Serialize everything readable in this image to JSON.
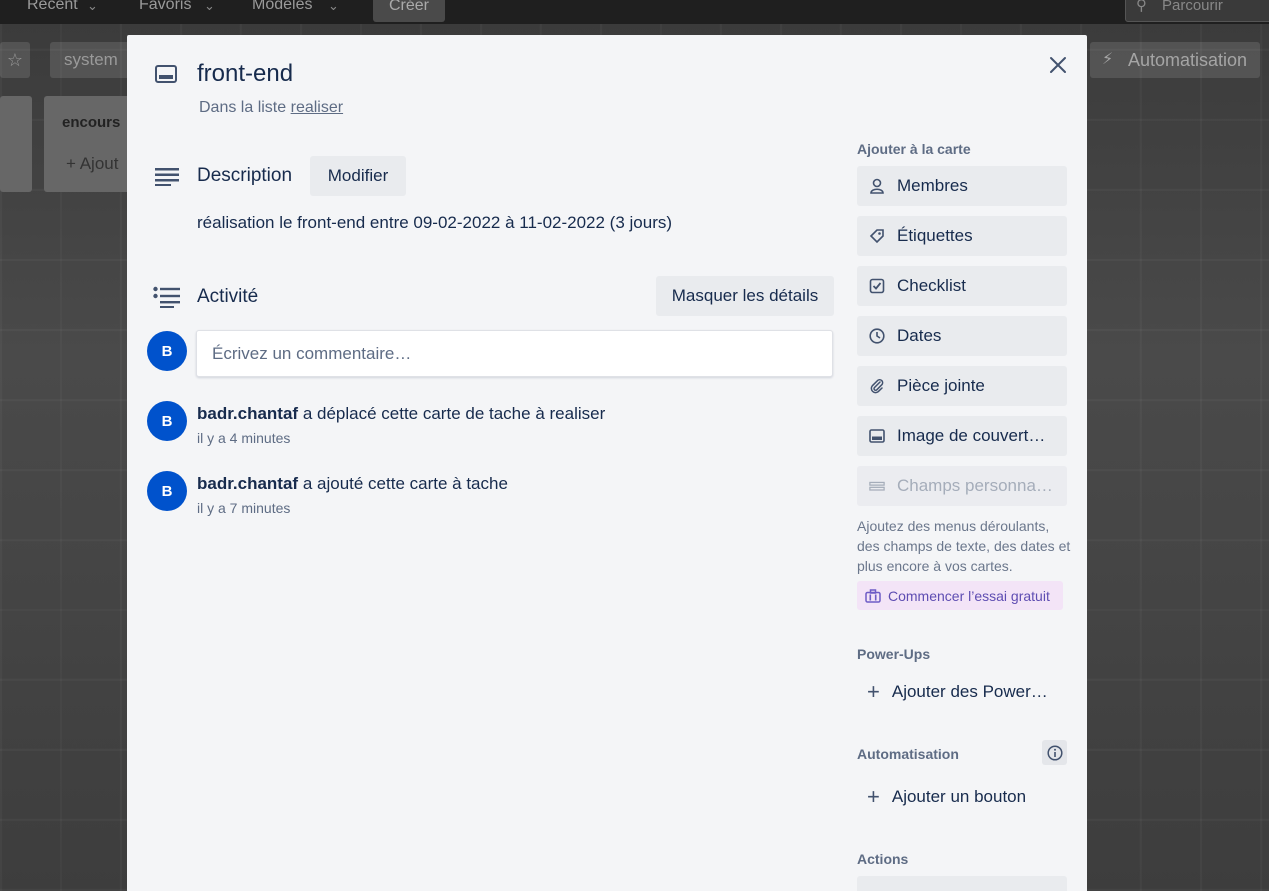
{
  "topbar": {
    "recent": "Récent",
    "favorites": "Favoris",
    "templates": "Modèles",
    "create": "Créer",
    "search_placeholder": "Parcourir"
  },
  "board": {
    "name": "system",
    "automation": "Automatisation",
    "list_title": "encours",
    "list_add": "+ Ajout"
  },
  "card": {
    "title": "front-end",
    "in_list_prefix": "Dans la liste",
    "list_name": "realiser",
    "description_heading": "Description",
    "modify_label": "Modifier",
    "description_text": "réalisation le front-end entre 09-02-2022 à 11-02-2022 (3 jours)",
    "activity_heading": "Activité",
    "hide_details_label": "Masquer les détails",
    "comment_placeholder": "Écrivez un commentaire…",
    "avatar_initial": "B",
    "activities": [
      {
        "user": "badr.chantaf",
        "action": "a déplacé cette carte de tache à realiser",
        "time": "il y a 4 minutes"
      },
      {
        "user": "badr.chantaf",
        "action": "a ajouté cette carte à tache",
        "time": "il y a 7 minutes"
      }
    ]
  },
  "sidebar": {
    "add_to_card_heading": "Ajouter à la carte",
    "members": "Membres",
    "labels": "Étiquettes",
    "checklist": "Checklist",
    "dates": "Dates",
    "attachment": "Pièce jointe",
    "cover": "Image de couvert…",
    "custom_fields": "Champs personna…",
    "custom_fields_note": "Ajoutez des menus déroulants, des champs de texte, des dates et plus encore à vos cartes.",
    "trial_label": "Commencer l’essai gratuit",
    "powerups_heading": "Power-Ups",
    "add_powerups": "Ajouter des Power…",
    "automation_heading": "Automatisation",
    "add_button": "Ajouter un bouton",
    "actions_heading": "Actions"
  }
}
